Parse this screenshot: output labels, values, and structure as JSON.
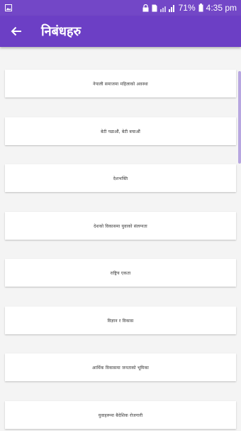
{
  "status": {
    "battery": "71%",
    "time": "4:35 pm"
  },
  "appbar": {
    "title": "निबंधहरु"
  },
  "essays": [
    {
      "label": "नेपाली समाजमा महिलाको अवस्था"
    },
    {
      "label": "बेटी पढाऔं, बेटी बचाऔं"
    },
    {
      "label": "देशभक्ति"
    },
    {
      "label": "देशको विकासमा युवाको संलग्नता"
    },
    {
      "label": "राष्ट्रिय एकता"
    },
    {
      "label": "विज्ञान र विकास"
    },
    {
      "label": "आर्थिक विकासमा जनताको भूमिका"
    },
    {
      "label": "युवाहरूमा बैदेशिक रोजगारी"
    }
  ],
  "colors": {
    "primary": "#6c3fc5",
    "statusbar": "#7347c7",
    "background": "#f4f4f4"
  }
}
